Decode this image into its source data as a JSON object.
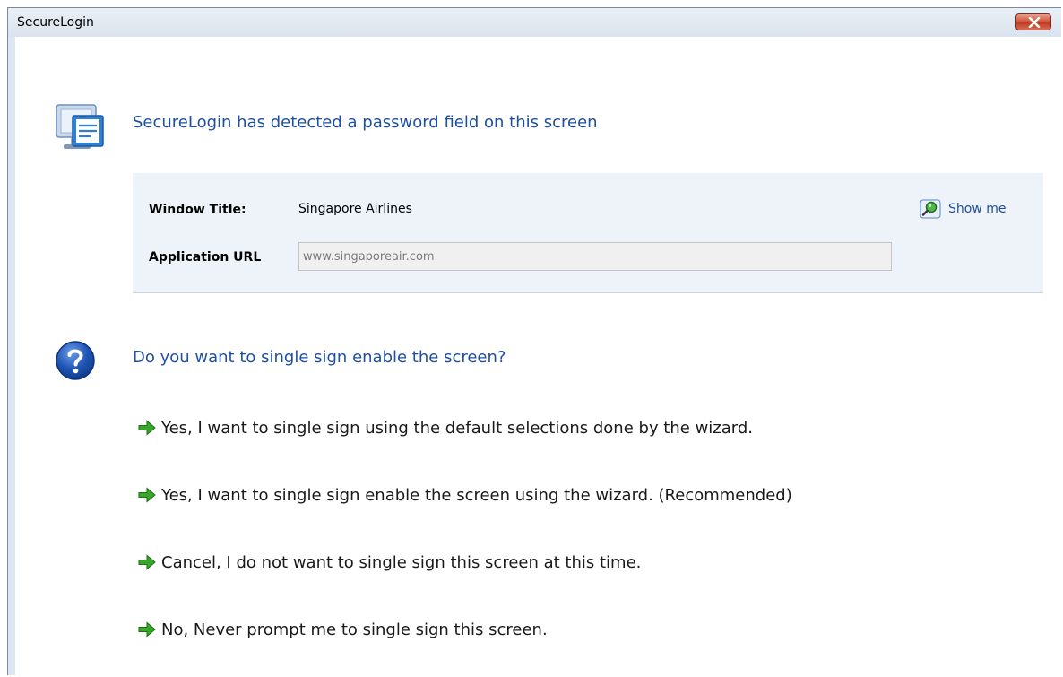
{
  "window": {
    "title": "SecureLogin"
  },
  "header": {
    "text": "SecureLogin has detected a password field on this screen"
  },
  "info": {
    "window_title_label": "Window Title:",
    "window_title_value": "Singapore Airlines",
    "app_url_label": "Application URL",
    "app_url_value": "www.singaporeair.com",
    "show_me_label": "Show me"
  },
  "question": {
    "text": "Do you want to single sign enable the screen?"
  },
  "options": [
    {
      "label": "Yes, I want to single sign using the default selections done by the wizard."
    },
    {
      "label": "Yes, I want to single sign enable the screen using the wizard. (Recommended)"
    },
    {
      "label": "Cancel, I do not want to single sign this screen at this time."
    },
    {
      "label": "No, Never prompt me to single sign this screen."
    }
  ],
  "icons": {
    "header": "monitor-document-icon",
    "show_me": "magnifier-icon",
    "question": "question-icon",
    "option_arrow": "green-arrow-icon",
    "close": "close-icon"
  },
  "colors": {
    "accent_text": "#1f4fa0",
    "panel_bg": "#eef3f9",
    "close_red": "#c13a22",
    "arrow_green": "#2f9a1d"
  }
}
